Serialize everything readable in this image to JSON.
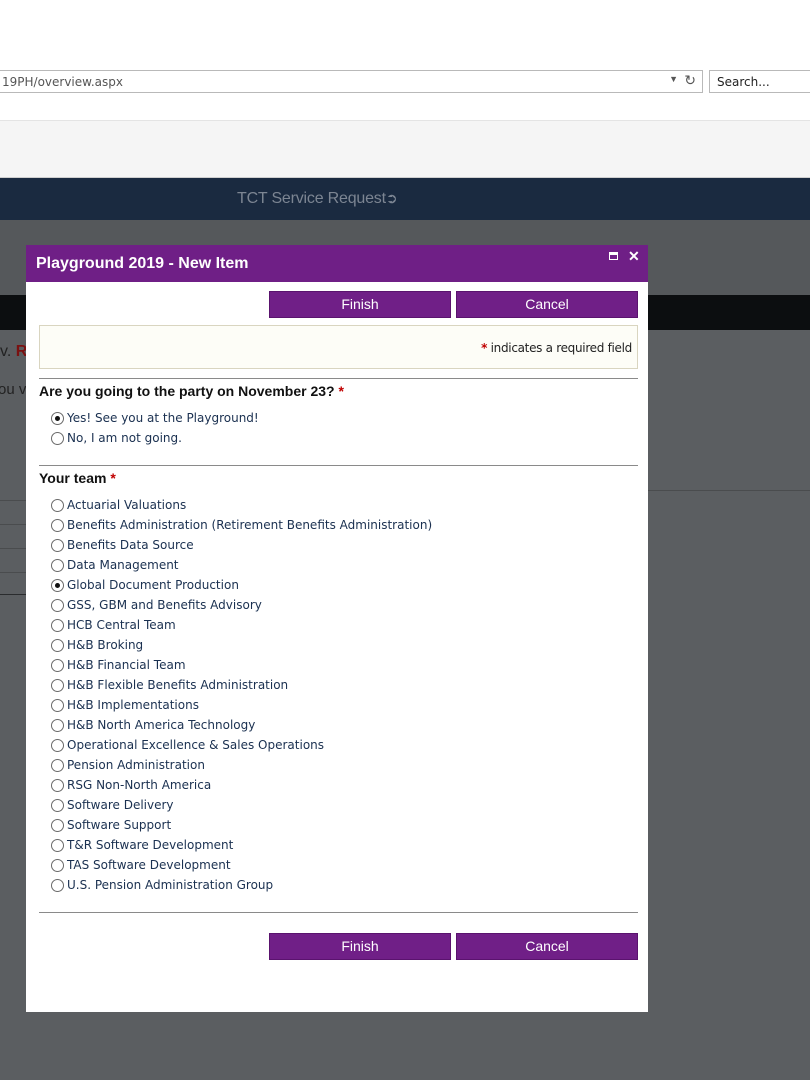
{
  "browser": {
    "address": "19PH/overview.aspx",
    "search_placeholder": "Search..."
  },
  "background": {
    "nav_link": "TCT Service Request",
    "left_text_1": "v. ",
    "left_text_1_red": "Re",
    "left_text_2": "ou v"
  },
  "dialog": {
    "title": "Playground 2019 - New Item",
    "finish_label": "Finish",
    "cancel_label": "Cancel",
    "required_note_star": "*",
    "required_note": " indicates a required field"
  },
  "question1": {
    "label": "Are you going to the party on November 23?",
    "required": "*",
    "options": [
      "Yes! See you at the Playground!",
      "No, I am not going."
    ],
    "selected_index": 0
  },
  "question2": {
    "label": "Your team",
    "required": "*",
    "options": [
      "Actuarial Valuations",
      "Benefits Administration (Retirement Benefits Administration)",
      "Benefits Data Source",
      "Data Management",
      "Global Document Production",
      "GSS, GBM and Benefits Advisory",
      "HCB Central Team",
      "H&B Broking",
      "H&B Financial Team",
      "H&B Flexible Benefits Administration",
      "H&B Implementations",
      "H&B North America Technology",
      "Operational Excellence & Sales Operations",
      "Pension Administration",
      "RSG Non-North America",
      "Software Delivery",
      "Software Support",
      "T&R Software Development",
      "TAS Software Development",
      "U.S. Pension Administration Group"
    ],
    "selected_index": 4
  }
}
